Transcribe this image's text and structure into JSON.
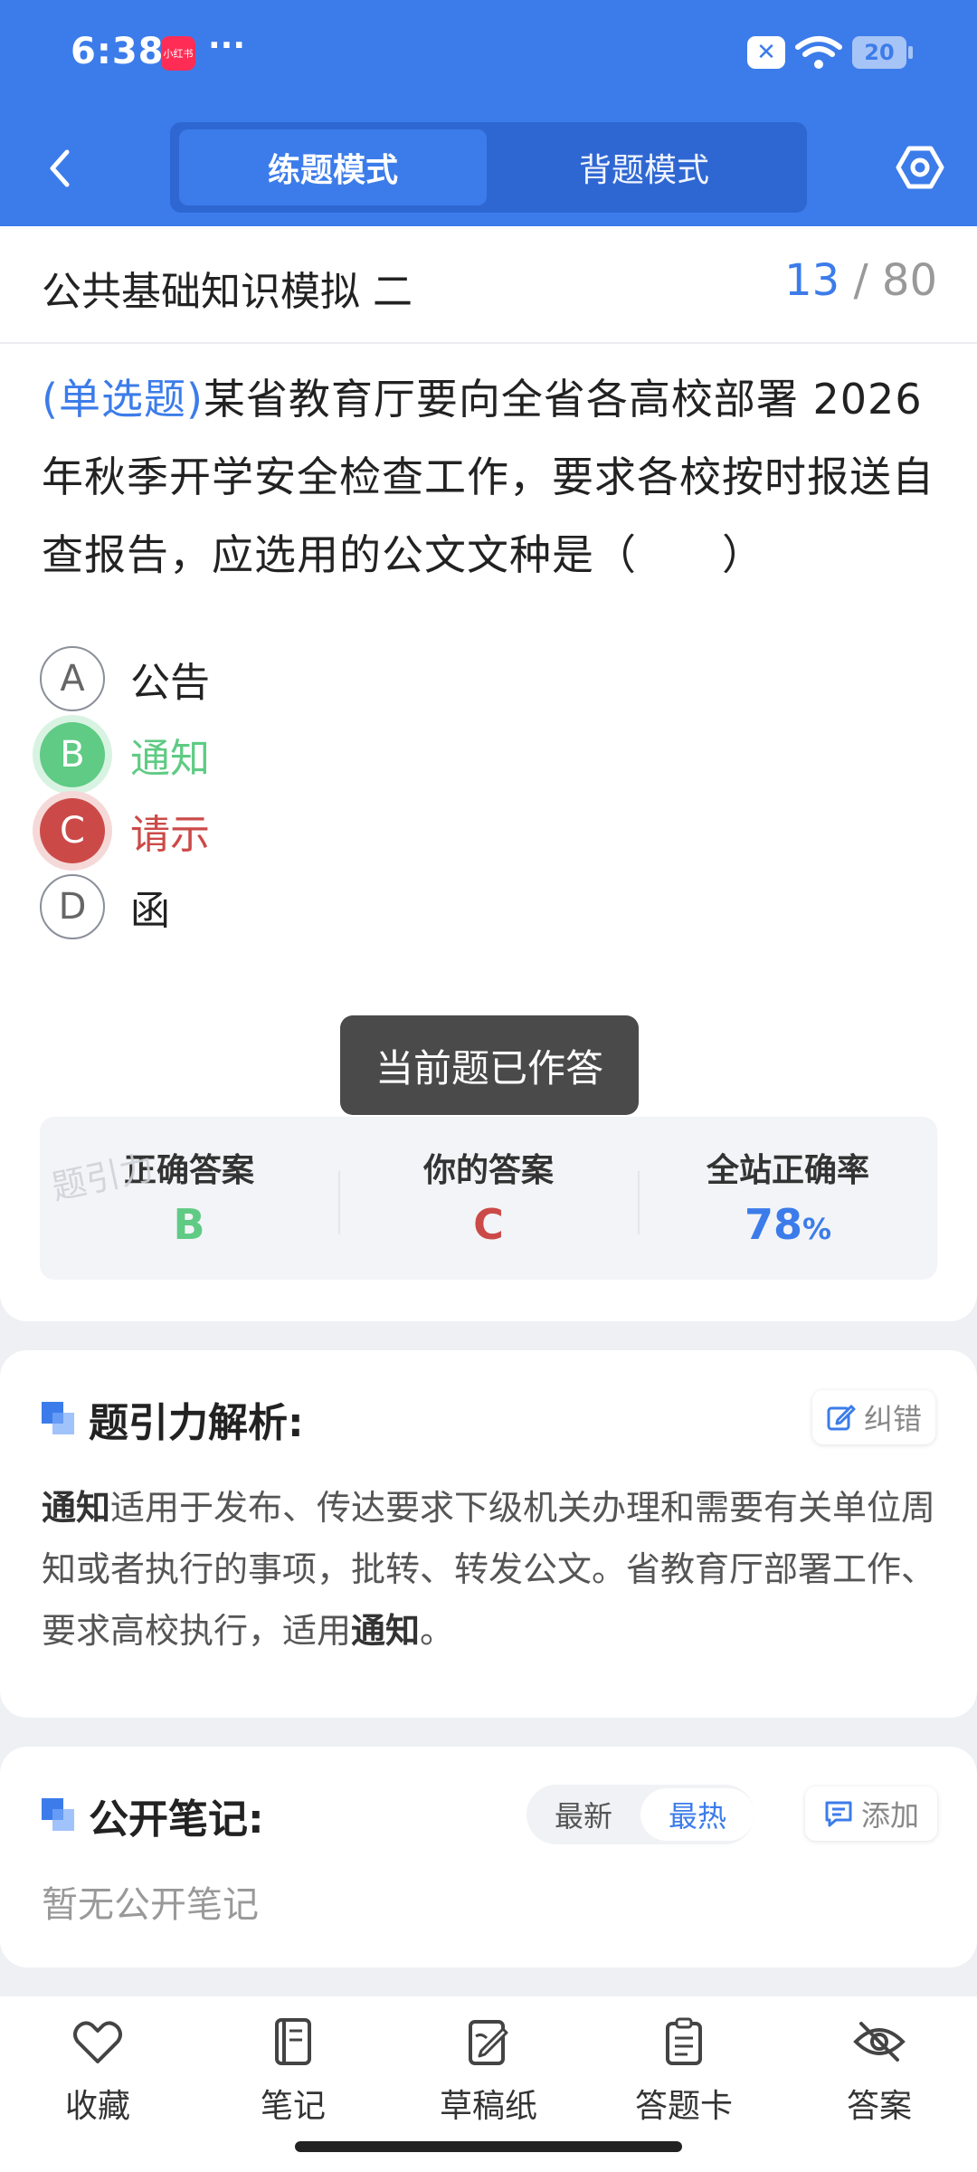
{
  "status_bar": {
    "time": "6:38",
    "app_badge": "小红书",
    "dots": "···",
    "battery": "20"
  },
  "header": {
    "tabs": [
      {
        "label": "练题模式",
        "active": true
      },
      {
        "label": "背题模式",
        "active": false
      }
    ]
  },
  "paper": {
    "title": "公共基础知识模拟 二",
    "current": "13",
    "separator": "/",
    "total": "80"
  },
  "question": {
    "type": "(单选题)",
    "text": "某省教育厅要向全省各高校部署 2026 年秋季开学安全检查工作，要求各校按时报送自查报告，应选用的公文文种是（　　）",
    "options": [
      {
        "letter": "A",
        "label": "公告",
        "state": "normal"
      },
      {
        "letter": "B",
        "label": "通知",
        "state": "correct"
      },
      {
        "letter": "C",
        "label": "请示",
        "state": "wrong"
      },
      {
        "letter": "D",
        "label": "函",
        "state": "normal"
      }
    ]
  },
  "toast": "当前题已作答",
  "answer_summary": {
    "correct_title": "正确答案",
    "correct_value": "B",
    "yours_title": "你的答案",
    "yours_value": "C",
    "rate_title": "全站正确率",
    "rate_value": "78",
    "rate_unit": "%",
    "watermark": "题引力"
  },
  "analysis": {
    "title": "题引力解析:",
    "correct_btn": "纠错",
    "bold_start": "通知",
    "text_mid": "适用于发布、传达要求下级机关办理和需要有关单位周知或者执行的事项，批转、转发公文。省教育厅部署工作、要求高校执行，适用",
    "bold_end": "通知",
    "text_end": "。"
  },
  "notes": {
    "title": "公开笔记:",
    "sort_latest": "最新",
    "sort_hot": "最热",
    "add_btn": "添加",
    "empty": "暂无公开笔记"
  },
  "bottom_nav": [
    {
      "label": "收藏",
      "icon": "heart-icon"
    },
    {
      "label": "笔记",
      "icon": "notebook-icon"
    },
    {
      "label": "草稿纸",
      "icon": "draft-icon"
    },
    {
      "label": "答题卡",
      "icon": "clipboard-icon"
    },
    {
      "label": "答案",
      "icon": "eye-off-icon"
    }
  ],
  "colors": {
    "primary": "#3c7cea",
    "correct": "#5fcb84",
    "wrong": "#cb4a48"
  }
}
